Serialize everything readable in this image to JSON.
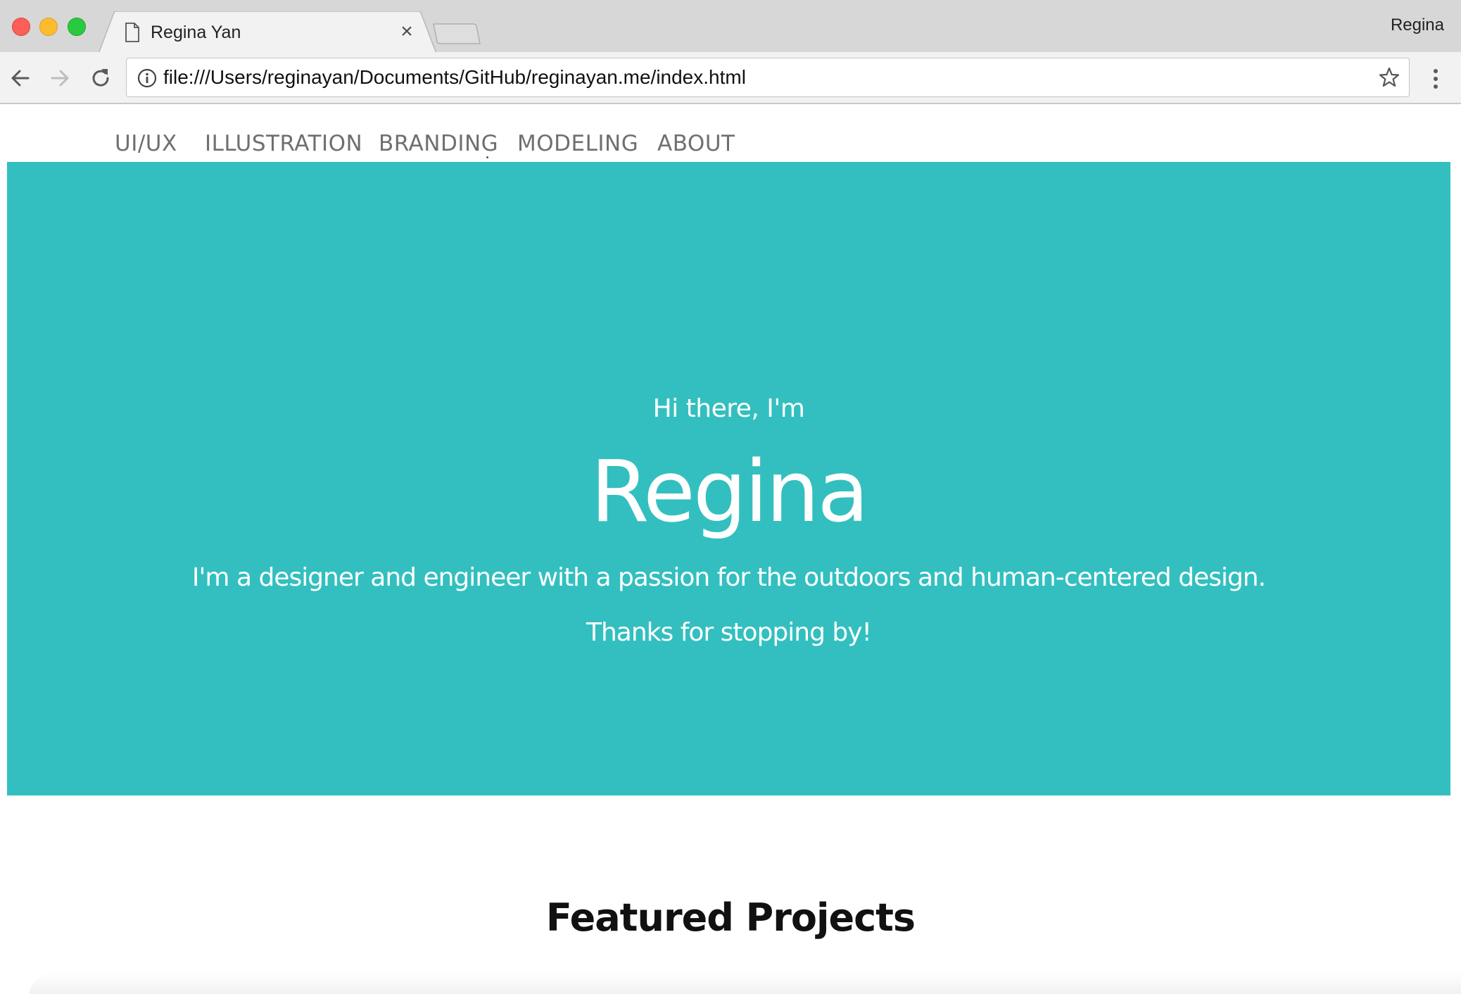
{
  "browser": {
    "tab_title": "Regina Yan",
    "tab_close": "×",
    "profile_name": "Regina",
    "url": "file:///Users/reginayan/Documents/GitHub/reginayan.me/index.html"
  },
  "nav": {
    "items": [
      "UI/UX",
      "ILLUSTRATION",
      "BRANDING",
      "MODELING",
      "ABOUT"
    ]
  },
  "hero": {
    "greeting": "Hi there, I'm",
    "name": "Regina",
    "tagline": "I'm a designer and engineer with a passion for the outdoors and human-centered design.",
    "thanks": "Thanks for stopping by!",
    "background_color": "#33bfbf"
  },
  "featured": {
    "title": "Featured Projects"
  }
}
